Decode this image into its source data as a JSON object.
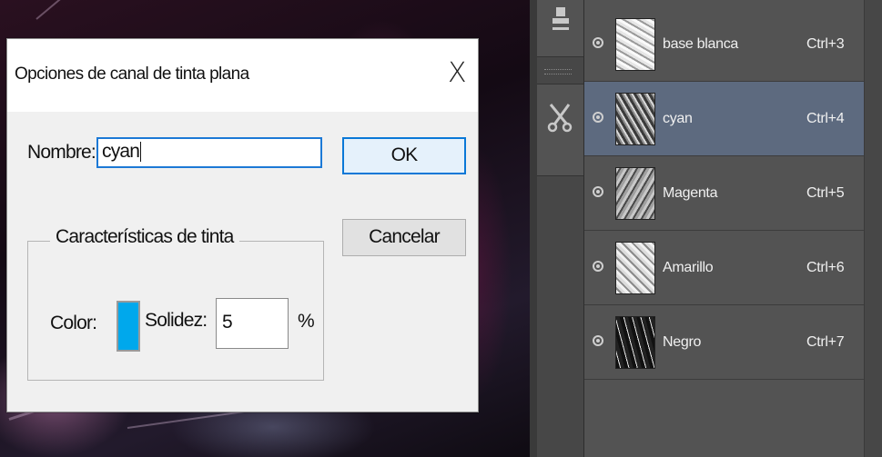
{
  "dialog": {
    "title": "Opciones de canal de tinta plana",
    "close_glyph": "X",
    "name_label": "Nombre:",
    "name_value": "cyan",
    "ok_label": "OK",
    "cancel_label": "Cancelar",
    "ink_group_title": "Características de tinta",
    "color_label": "Color:",
    "color_value": "#00a8ec",
    "solidity_label": "Solidez:",
    "solidity_value": "5",
    "percent_sign": "%"
  },
  "tools": {
    "icons": [
      "stamp-icon",
      "scissors-icon"
    ]
  },
  "channels": [
    {
      "name": "base blanca",
      "shortcut": "Ctrl+3",
      "selected": false,
      "thumb": "light"
    },
    {
      "name": "cyan",
      "shortcut": "Ctrl+4",
      "selected": true,
      "thumb": "dark"
    },
    {
      "name": "Magenta",
      "shortcut": "Ctrl+5",
      "selected": false,
      "thumb": "mid"
    },
    {
      "name": "Amarillo",
      "shortcut": "Ctrl+6",
      "selected": false,
      "thumb": "light"
    },
    {
      "name": "Negro",
      "shortcut": "Ctrl+7",
      "selected": false,
      "thumb": "black"
    }
  ],
  "colors": {
    "panel_bg": "#535353",
    "selected_row": "#5d6a7f",
    "accent_blue": "#0a78d7"
  }
}
